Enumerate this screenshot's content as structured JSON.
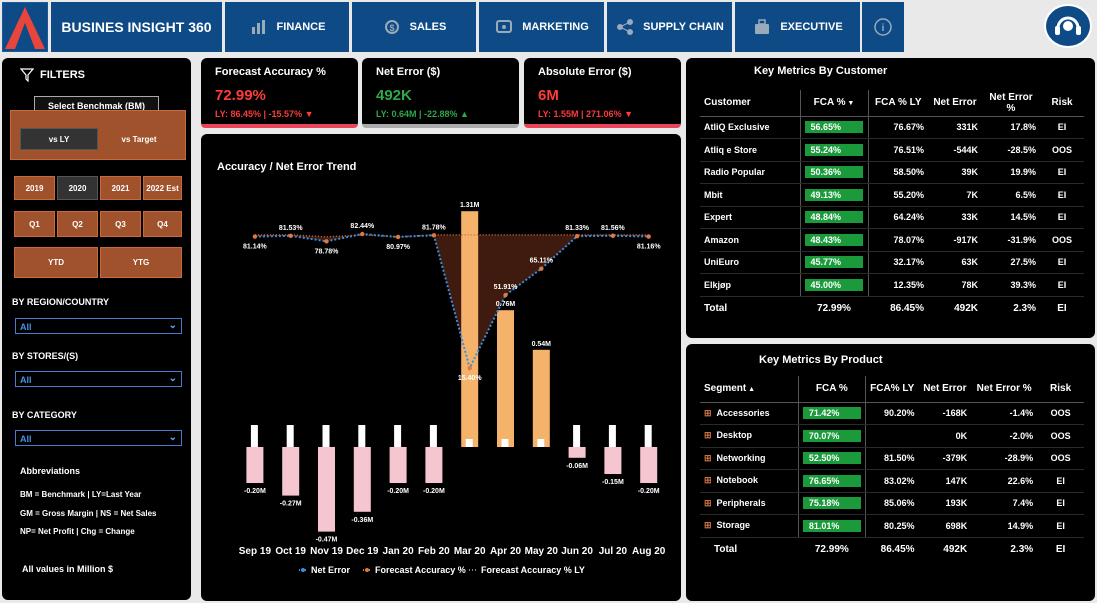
{
  "nav": {
    "brand": "BUSINES INSIGHT 360",
    "tabs": [
      {
        "label": "FINANCE",
        "icon": "finance-icon"
      },
      {
        "label": "SALES",
        "icon": "sales-icon"
      },
      {
        "label": "MARKETING",
        "icon": "marketing-icon"
      },
      {
        "label": "SUPPLY CHAIN",
        "icon": "supply-chain-icon"
      },
      {
        "label": "EXECUTIVE",
        "icon": "executive-icon"
      }
    ]
  },
  "filters": {
    "title": "FILTERS",
    "benchmark_title": "Select Benchmak (BM)",
    "benchmark_options": [
      "vs LY",
      "vs Target"
    ],
    "years": [
      "2019",
      "2020",
      "2021",
      "2022 Est"
    ],
    "quarters": [
      "Q1",
      "Q2",
      "Q3",
      "Q4"
    ],
    "periods": [
      "YTD",
      "YTG"
    ],
    "region_label": "BY REGION/COUNTRY",
    "region_value": "All",
    "stores_label": "BY STORES/(S)",
    "stores_value": "All",
    "category_label": "BY CATEGORY",
    "category_value": "All",
    "abbr_title": "Abbreviations",
    "abbr_lines": [
      "BM = Benchmark | LY=Last Year",
      "GM = Gross Margin | NS = Net Sales",
      "NP= Net Profit | Chg = Change"
    ],
    "footnote": "All values in Million $"
  },
  "kpis": [
    {
      "title": "Forecast Accuracy %",
      "value": "72.99%",
      "sub": "LY: 86.45% | -15.57% ▼",
      "color": "#ff3b3b"
    },
    {
      "title": "Net Error ($)",
      "value": "492K",
      "sub": "LY: 0.64M | -22.88% ▲",
      "color": "#2ea84a"
    },
    {
      "title": "Absolute Error ($)",
      "value": "6M",
      "sub": "LY: 1.55M | 271.06% ▼",
      "color": "#ff3b3b"
    }
  ],
  "chart_data": {
    "type": "bar",
    "title": "Accuracy / Net Error Trend",
    "categories": [
      "Sep 19",
      "Oct 19",
      "Nov 19",
      "Dec 19",
      "Jan 20",
      "Feb 20",
      "Mar 20",
      "Apr 20",
      "May 20",
      "Jun 20",
      "Jul 20",
      "Aug 20"
    ],
    "series": [
      {
        "name": "Net Error",
        "type": "bar",
        "values": [
          -0.2,
          -0.27,
          -0.47,
          -0.36,
          -0.2,
          -0.2,
          1.31,
          0.76,
          0.54,
          -0.06,
          -0.15,
          -0.2
        ],
        "labels": [
          "-0.20M",
          "-0.27M",
          "-0.47M",
          "-0.36M",
          "-0.20M",
          "-0.20M",
          "1.31M",
          "0.76M",
          "0.54M",
          "-0.06M",
          "-0.15M",
          "-0.20M"
        ]
      },
      {
        "name": "Forecast Accuracy %",
        "type": "line",
        "values": [
          81.14,
          81.53,
          78.78,
          82.44,
          80.97,
          81.78,
          15.4,
          51.91,
          65.11,
          81.33,
          81.56,
          81.16
        ],
        "labels": [
          "81.14%",
          "81.53%",
          "78.78%",
          "82.44%",
          "80.97%",
          "81.78%",
          "15.40%",
          "51.91%",
          "65.11%",
          "81.33%",
          "81.56%",
          "81.16%"
        ]
      },
      {
        "name": "Forecast Accuracy % LY",
        "type": "line",
        "values": [
          82,
          82,
          81,
          82,
          81,
          82,
          82,
          82,
          82,
          82,
          82,
          82
        ]
      }
    ],
    "legend_position": "bottom",
    "colors": {
      "net_error_pos": "#f5b26b",
      "net_error_neg": "#f5c6d0",
      "fca": "#3a8de0",
      "fca_ly": "#c87040"
    }
  },
  "customer_table": {
    "title": "Key Metrics By Customer",
    "headers": [
      "Customer",
      "FCA %",
      "FCA % LY",
      "Net Error",
      "Net Error %",
      "Risk"
    ],
    "rows": [
      [
        "AtliQ Exclusive",
        "56.65%",
        "76.67%",
        "331K",
        "17.8%",
        "EI"
      ],
      [
        "Atliq e Store",
        "55.24%",
        "76.51%",
        "-544K",
        "-28.5%",
        "OOS"
      ],
      [
        "Radio Popular",
        "50.36%",
        "58.50%",
        "39K",
        "19.9%",
        "EI"
      ],
      [
        "Mbit",
        "49.13%",
        "55.20%",
        "7K",
        "6.5%",
        "EI"
      ],
      [
        "Expert",
        "48.84%",
        "64.24%",
        "33K",
        "14.5%",
        "EI"
      ],
      [
        "Amazon",
        "48.43%",
        "78.07%",
        "-917K",
        "-31.9%",
        "OOS"
      ],
      [
        "UniEuro",
        "45.77%",
        "32.17%",
        "63K",
        "27.5%",
        "EI"
      ],
      [
        "Elkjøp",
        "45.00%",
        "12.35%",
        "78K",
        "39.3%",
        "EI"
      ]
    ],
    "total": [
      "Total",
      "72.99%",
      "86.45%",
      "492K",
      "2.3%",
      "EI"
    ]
  },
  "product_table": {
    "title": "Key Metrics By Product",
    "headers": [
      "Segment",
      "FCA %",
      "FCA% LY",
      "Net Error",
      "Net Error %",
      "Risk"
    ],
    "rows": [
      [
        "Accessories",
        "71.42%",
        "90.20%",
        "-168K",
        "-1.4%",
        "OOS"
      ],
      [
        "Desktop",
        "70.07%",
        "",
        "0K",
        "-2.0%",
        "OOS"
      ],
      [
        "Networking",
        "52.50%",
        "81.50%",
        "-379K",
        "-28.9%",
        "OOS"
      ],
      [
        "Notebook",
        "76.65%",
        "83.02%",
        "147K",
        "22.6%",
        "EI"
      ],
      [
        "Peripherals",
        "75.18%",
        "85.06%",
        "193K",
        "7.4%",
        "EI"
      ],
      [
        "Storage",
        "81.01%",
        "80.25%",
        "698K",
        "14.9%",
        "EI"
      ]
    ],
    "total": [
      "Total",
      "72.99%",
      "86.45%",
      "492K",
      "2.3%",
      "EI"
    ]
  }
}
